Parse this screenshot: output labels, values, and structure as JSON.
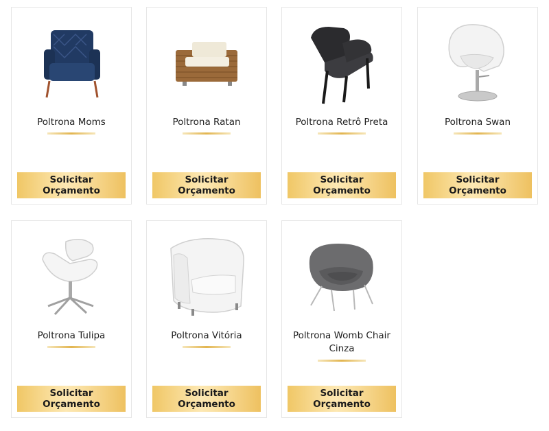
{
  "products": [
    {
      "name": "Poltrona Moms",
      "button": "Solicitar Orçamento",
      "image": "navy-armchair"
    },
    {
      "name": "Poltrona Ratan",
      "button": "Solicitar Orçamento",
      "image": "rattan-armchair"
    },
    {
      "name": "Poltrona Retrô Preta",
      "button": "Solicitar Orçamento",
      "image": "black-retro-chair"
    },
    {
      "name": "Poltrona Swan",
      "button": "Solicitar Orçamento",
      "image": "white-swan-chair"
    },
    {
      "name": "Poltrona Tulipa",
      "button": "Solicitar Orçamento",
      "image": "white-tulip-chair"
    },
    {
      "name": "Poltrona Vitória",
      "button": "Solicitar Orçamento",
      "image": "white-tub-chair"
    },
    {
      "name": "Poltrona Womb Chair Cinza",
      "button": "Solicitar Orçamento",
      "image": "gray-womb-chair"
    }
  ],
  "colors": {
    "accent_gold": "#e2b550",
    "button_gold_light": "#fde8b3",
    "button_gold_dark": "#f0c766",
    "card_border": "#e6e6e6"
  }
}
